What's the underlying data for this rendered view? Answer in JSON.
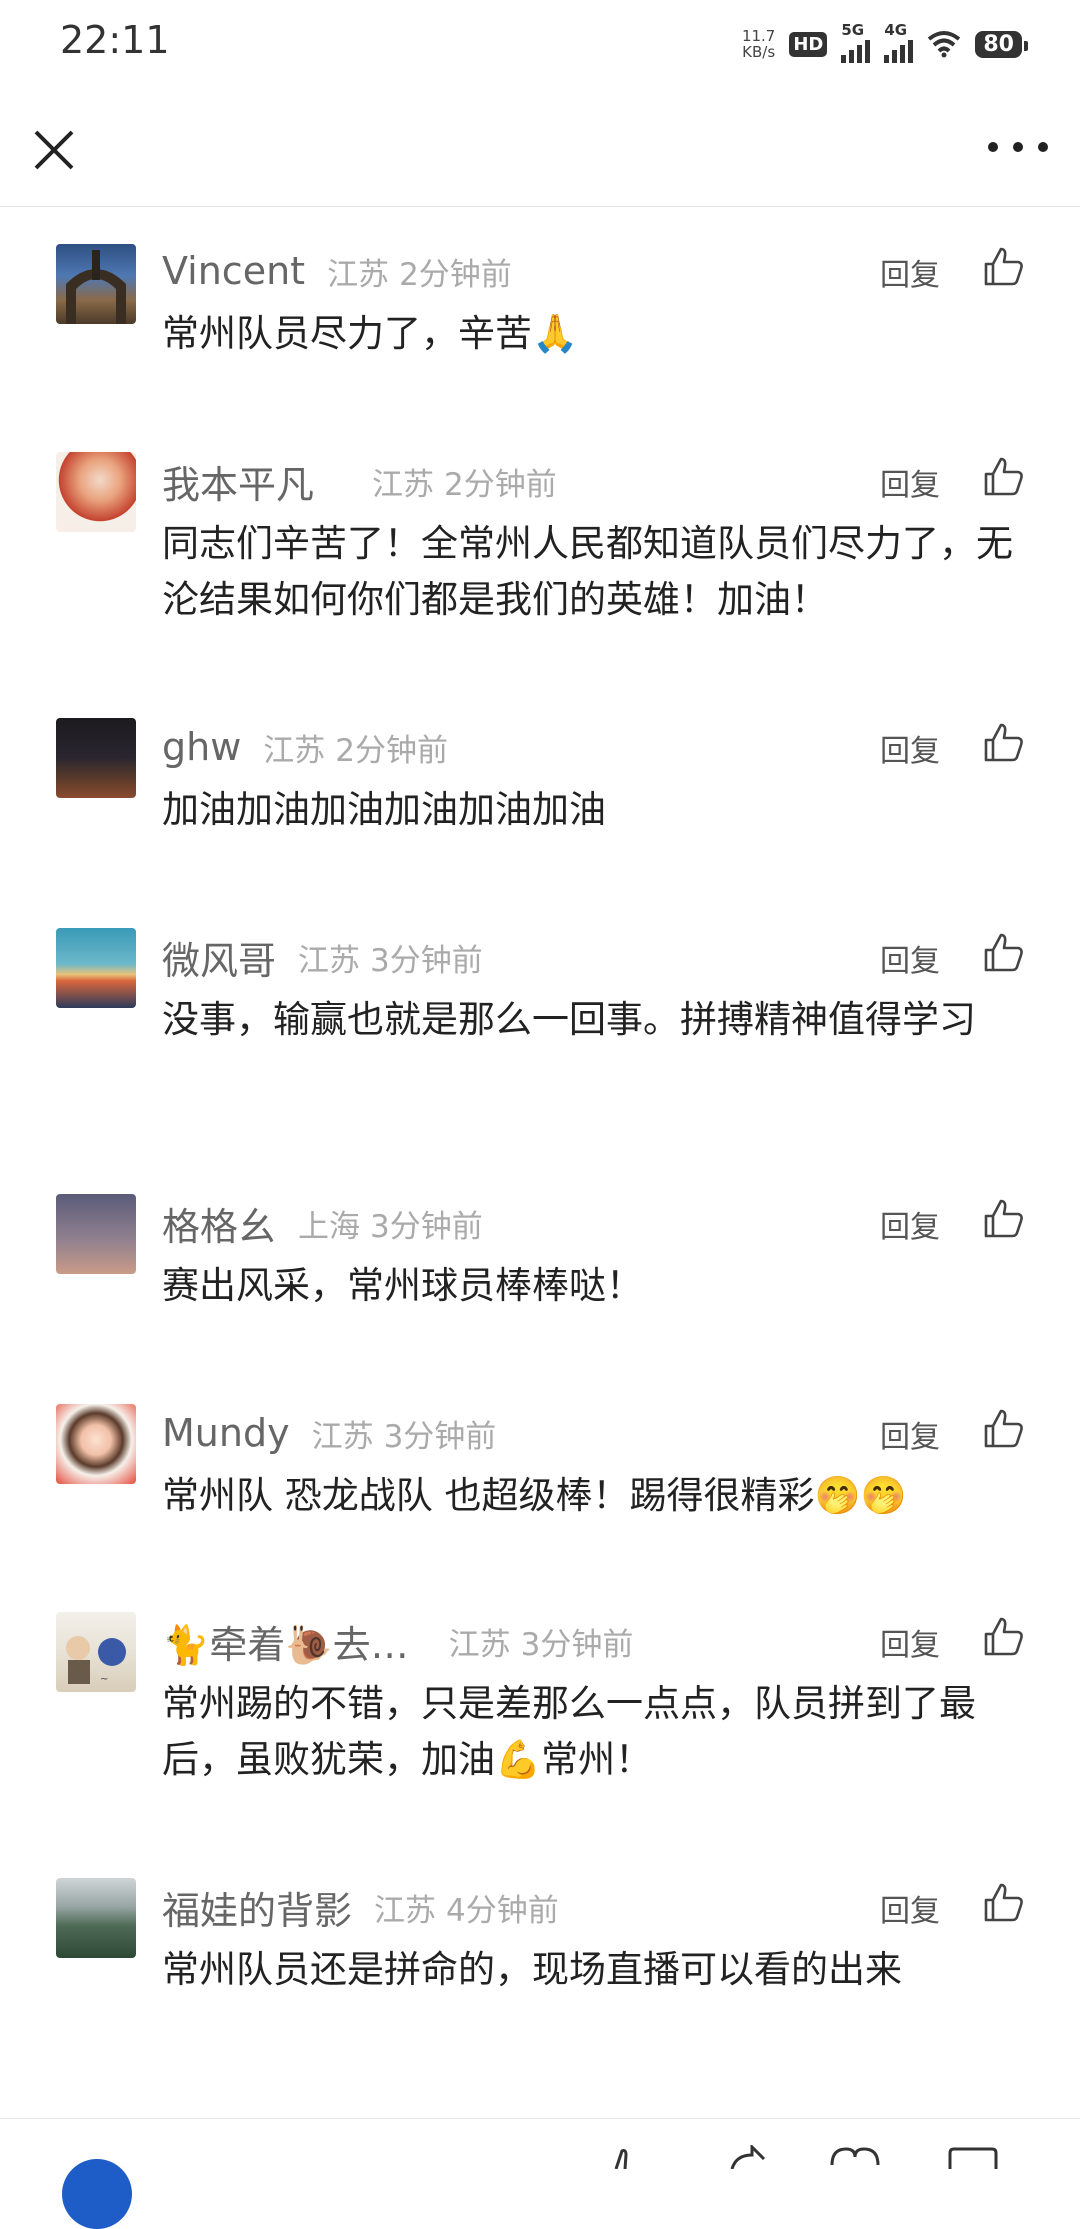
{
  "status_bar": {
    "time": "22:11",
    "net_speed_value": "11.7",
    "net_speed_unit": "KB/s",
    "hd_badge": "HD",
    "signal_1": "5G",
    "signal_2": "4G",
    "battery": "80"
  },
  "header": {
    "close_icon": "close-icon",
    "more_icon": "more-icon"
  },
  "comments": [
    {
      "name": "Vincent",
      "region": "江苏",
      "time": "2分钟前",
      "reply": "回复",
      "text": "常州队员尽力了，辛苦🙏"
    },
    {
      "name": "我本平凡",
      "region": "江苏",
      "time": "2分钟前",
      "reply": "回复",
      "text": "同志们辛苦了！全常州人民都知道队员们尽力了，无沦结果如何你们都是我们的英雄！加油！"
    },
    {
      "name": "ghw",
      "region": "江苏",
      "time": "2分钟前",
      "reply": "回复",
      "text": "加油加油加油加油加油加油"
    },
    {
      "name": "微风哥",
      "region": "江苏",
      "time": "3分钟前",
      "reply": "回复",
      "text": "没事，输赢也就是那么一回事。拼搏精神值得学习"
    },
    {
      "name": "格格幺",
      "region": "上海",
      "time": "3分钟前",
      "reply": "回复",
      "text": "赛出风采，常州球员棒棒哒！"
    },
    {
      "name": "Mundy",
      "region": "江苏",
      "time": "3分钟前",
      "reply": "回复",
      "text": "常州队 恐龙战队 也超级棒！踢得很精彩🤭🤭"
    },
    {
      "name": "🐈牵着🐌去…",
      "region": "江苏",
      "time": "3分钟前",
      "reply": "回复",
      "text": "常州踢的不错，只是差那么一点点，队员拼到了最后，虽败犹荣，加油💪常州！"
    },
    {
      "name": "福娃的背影",
      "region": "江苏",
      "time": "4分钟前",
      "reply": "回复",
      "text": "常州队员还是拼命的，现场直播可以看的出来"
    }
  ],
  "colors": {
    "name": "#666666",
    "meta": "#aaaaaa",
    "text": "#222222"
  }
}
